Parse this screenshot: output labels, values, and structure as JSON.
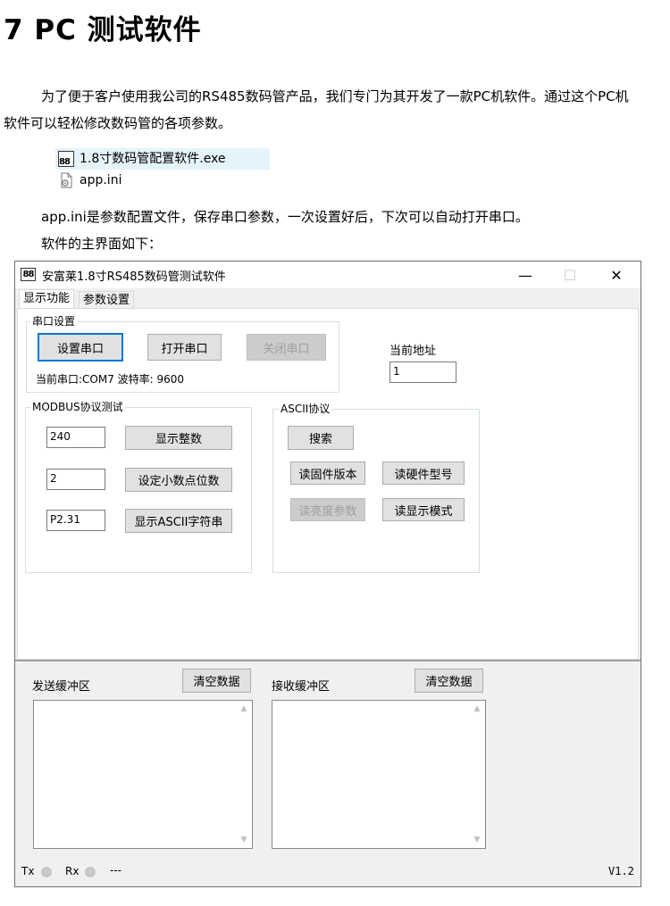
{
  "heading": "7 PC 测试软件",
  "intro_line1": "为了便于客户使用我公司的RS485数码管产品，我们专门为其开发了一款PC机软件。通过这个PC机",
  "intro_line2": "软件可以轻松修改数码管的各项参数。",
  "files": [
    {
      "name": "1.8寸数码管配置软件.exe",
      "icon": "app-8-icon"
    },
    {
      "name": "app.ini",
      "icon": "config-file-icon"
    }
  ],
  "note1": "app.ini是参数配置文件，保存串口参数，一次设置好后，下次可以自动打开串口。",
  "note2": "软件的主界面如下：",
  "window": {
    "title": "安富莱1.8寸RS485数码管测试软件",
    "icon_text": "88",
    "controls": {
      "minimize": "—",
      "maximize": "☐",
      "close": "✕"
    },
    "tabs": [
      "显示功能",
      "参数设置"
    ],
    "serial_group": {
      "title": "串口设置",
      "buttons": [
        "设置串口",
        "打开串口",
        "关闭串口"
      ],
      "status": "当前串口:COM7 波特率: 9600"
    },
    "address": {
      "label": "当前地址",
      "value": "1"
    },
    "modbus_group": {
      "title": "MODBUS协议测试",
      "rows": [
        {
          "value": "240",
          "button": "显示整数"
        },
        {
          "value": "2",
          "button": "设定小数点位数"
        },
        {
          "value": "P2.31",
          "button": "显示ASCII字符串"
        }
      ]
    },
    "ascii_group": {
      "title": "ASCII协议",
      "search": "搜索",
      "read_fw": "读固件版本",
      "read_hw": "读硬件型号",
      "read_brightness": "读亮度参数",
      "read_display_mode": "读显示模式"
    },
    "send_buffer": {
      "label": "发送缓冲区",
      "clear": "清空数据"
    },
    "recv_buffer": {
      "label": "接收缓冲区",
      "clear": "清空数据"
    },
    "status_bar": {
      "tx": "Tx",
      "rx": "Rx",
      "dash": "---",
      "version": "V1.2"
    }
  },
  "colors": {
    "focus_border": "#0078d7",
    "selected_row": "#e5f3fb",
    "indicator": "#c8c8c8"
  }
}
